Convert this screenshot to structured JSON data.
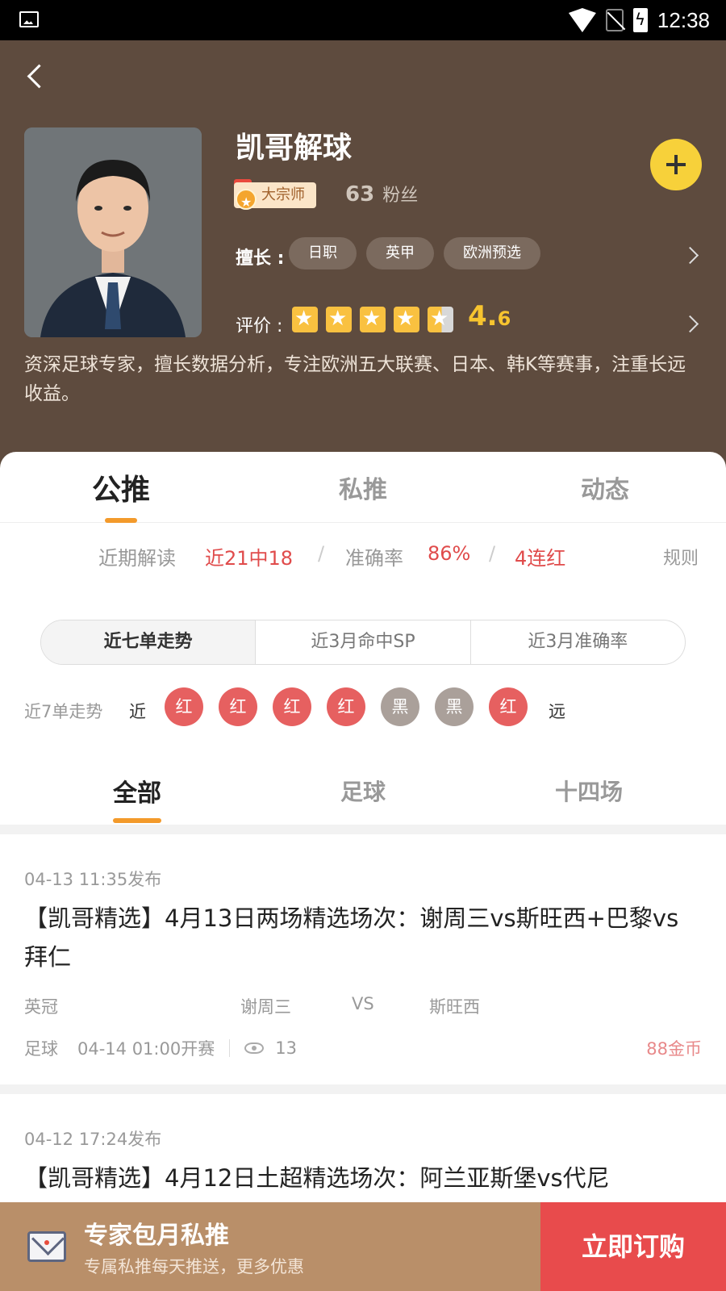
{
  "status_bar": {
    "time": "12:38"
  },
  "expert": {
    "name": "凯哥解球",
    "badge": "大宗师",
    "fans_count": "63",
    "fans_label": "粉丝",
    "skills_label": "擅长 :",
    "skills": [
      "日职",
      "英甲",
      "欧洲预选"
    ],
    "rating_label": "评价 :",
    "rating_stars": 4.6,
    "rating_int": "4.",
    "rating_dec": "6",
    "description": "资深足球专家，擅长数据分析，专注欧洲五大联赛、日本、韩K等赛事，注重长远收益。"
  },
  "main_tabs": [
    "公推",
    "私推",
    "动态"
  ],
  "stats": {
    "recent_label": "近期解读",
    "recent_value": "近21中18",
    "accuracy_label": "准确率",
    "accuracy_value": "86%",
    "streak_value": "4连红",
    "rules_label": "规则"
  },
  "segments": [
    "近七单走势",
    "近3月命中SP",
    "近3月准确率"
  ],
  "trend": {
    "label": "近7单走势",
    "near": "近",
    "far": "远",
    "results": [
      "红",
      "红",
      "红",
      "红",
      "黑",
      "黑",
      "红"
    ]
  },
  "sub_tabs": [
    "全部",
    "足球",
    "十四场"
  ],
  "cards": [
    {
      "time": "04-13 11:35发布",
      "title": "【凯哥精选】4月13日两场精选场次：谢周三vs斯旺西+巴黎vs拜仁",
      "league": "英冠",
      "home": "谢周三",
      "vs": "VS",
      "away": "斯旺西",
      "sport": "足球",
      "kickoff": "04-14 01:00开赛",
      "views": "13",
      "price": "88金币"
    },
    {
      "time": "04-12 17:24发布",
      "title": "【凯哥精选】4月12日土超精选场次：阿兰亚斯堡vs代尼"
    }
  ],
  "bottom_bar": {
    "title": "专家包月私推",
    "subtitle": "专属私推每天推送，更多优惠",
    "button": "立即订购"
  },
  "colors": {
    "header_bg": "#5e4b3e",
    "accent_orange": "#f39a2b",
    "red": "#e04b4b",
    "follow_yellow": "#f7d13a",
    "bottom_left": "#b98f69",
    "bottom_button": "#e84b4c"
  }
}
